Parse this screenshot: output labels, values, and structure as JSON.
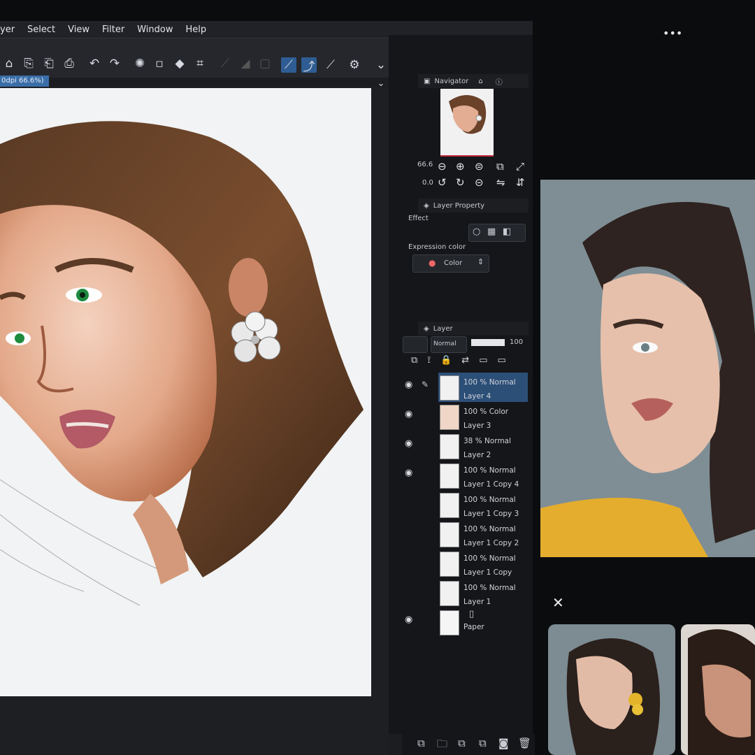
{
  "menu": [
    "yer",
    "Select",
    "View",
    "Filter",
    "Window",
    "Help"
  ],
  "doc_tab": "0dpi 66.6%)",
  "navigator": {
    "title": "Navigator",
    "zoom": "66.6",
    "rotation": "0.0"
  },
  "layer_property": {
    "title": "Layer Property",
    "effect_label": "Effect",
    "expression_label": "Expression color",
    "expression_value": "Color"
  },
  "layer_panel": {
    "title": "Layer",
    "blend_mode": "Normal",
    "opacity": "100",
    "layers": [
      {
        "opacity": "100 %",
        "mode": "Normal",
        "name": "Layer 4"
      },
      {
        "opacity": "100 %",
        "mode": "Color",
        "name": "Layer 3"
      },
      {
        "opacity": "38 %",
        "mode": "Normal",
        "name": "Layer 2"
      },
      {
        "opacity": "100 %",
        "mode": "Normal",
        "name": "Layer 1 Copy 4"
      },
      {
        "opacity": "100 %",
        "mode": "Normal",
        "name": "Layer 1 Copy 3"
      },
      {
        "opacity": "100 %",
        "mode": "Normal",
        "name": "Layer 1 Copy 2"
      },
      {
        "opacity": "100 %",
        "mode": "Normal",
        "name": "Layer 1 Copy"
      },
      {
        "opacity": "100 %",
        "mode": "Normal",
        "name": "Layer 1"
      }
    ],
    "paper": "Paper"
  },
  "overlay": {
    "more": "•••",
    "close": "✕"
  },
  "colors": {
    "accent": "#2f5d93",
    "panel": "#151619",
    "canvas_bg": "#1d1f23"
  }
}
